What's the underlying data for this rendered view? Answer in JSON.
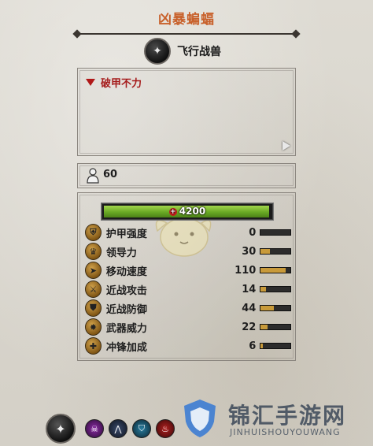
{
  "unit": {
    "name": "凶暴蝙蝠",
    "type_label": "飞行战兽",
    "ability": "破甲不力",
    "unit_size": "60",
    "hp": "4200"
  },
  "stats": [
    {
      "label": "护甲强度",
      "value": "0",
      "icon": "armor-icon",
      "fill": 0.0
    },
    {
      "label": "领导力",
      "value": "30",
      "icon": "leadership-icon",
      "fill": 0.3
    },
    {
      "label": "移动速度",
      "value": "110",
      "icon": "speed-icon",
      "fill": 0.85
    },
    {
      "label": "近战攻击",
      "value": "14",
      "icon": "melee-attack-icon",
      "fill": 0.18
    },
    {
      "label": "近战防御",
      "value": "44",
      "icon": "melee-defence-icon",
      "fill": 0.45
    },
    {
      "label": "武器威力",
      "value": "22",
      "icon": "weapon-strength-icon",
      "fill": 0.22
    },
    {
      "label": "冲锋加成",
      "value": "6",
      "icon": "charge-bonus-icon",
      "fill": 0.06
    }
  ],
  "bottom_icons": [
    "faction-emblem-icon",
    "skull-icon",
    "wings-icon",
    "shield-icon",
    "fire-icon"
  ],
  "watermark": {
    "text": "锦汇手游网",
    "sub": "JINHUISHOUYOUWANG"
  },
  "colors": {
    "title": "#c8602a",
    "ability": "#a51b1b",
    "hp_bar": "#69a925",
    "stat_bar": "#c89a3a"
  },
  "hp_fill_fraction": 0.99
}
